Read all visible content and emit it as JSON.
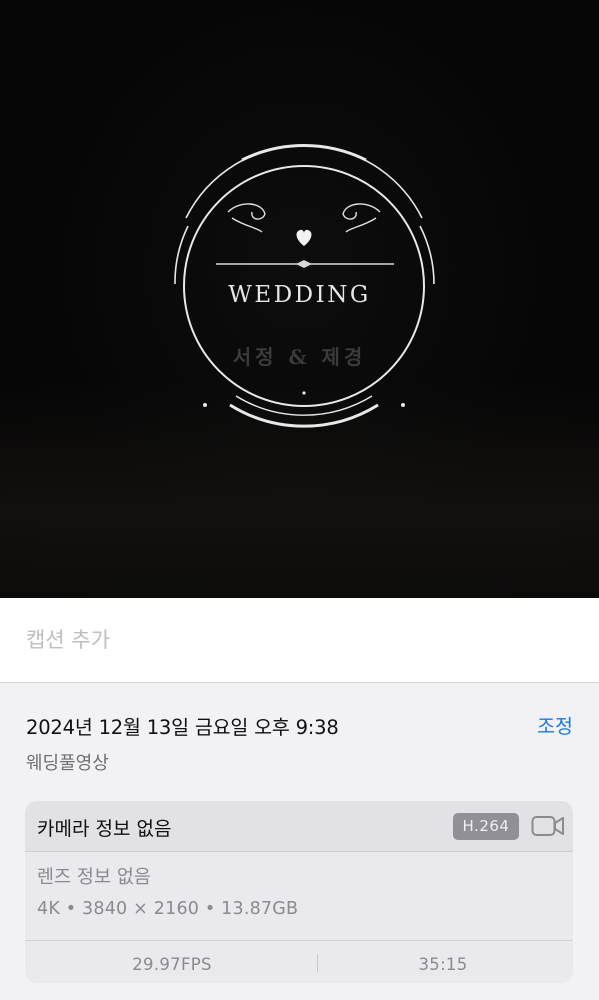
{
  "video": {
    "emblem_title": "WEDDING",
    "emblem_names": "서정 & 제경"
  },
  "caption": {
    "placeholder": "캡션 추가",
    "value": ""
  },
  "info": {
    "datetime": "2024년 12월 13일 금요일 오후 9:38",
    "adjust_label": "조정",
    "filename": "웨딩풀영상",
    "accent_color": "#1a7ae0"
  },
  "media_card": {
    "camera": "카메라 정보 없음",
    "codec": "H.264",
    "camera_icon": "video-camera-icon",
    "lens": "렌즈 정보 없음",
    "specs": "4K • 3840 × 2160 • 13.87GB",
    "fps": "29.97FPS",
    "duration": "35:15"
  }
}
